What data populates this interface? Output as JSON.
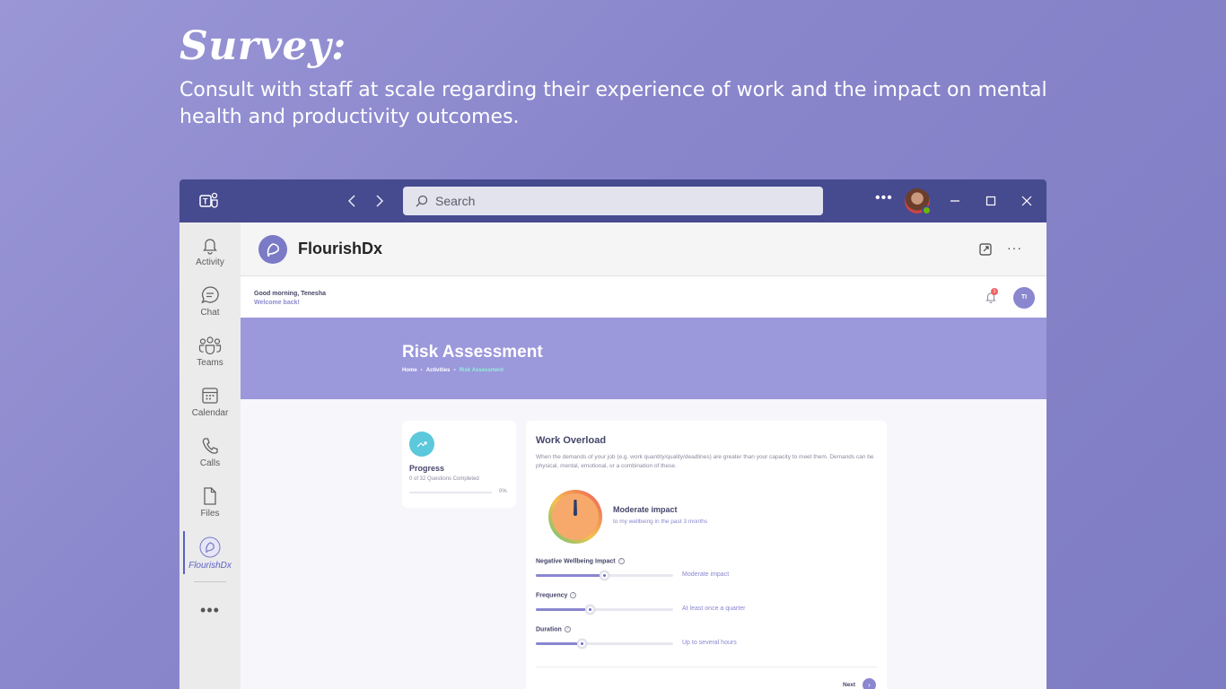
{
  "hero": {
    "title": "Survey:",
    "subtitle": "Consult with staff at scale regarding their experience of work and the impact on mental health and productivity outcomes."
  },
  "titlebar": {
    "search_placeholder": "Search",
    "more_icon": "more-horizontal-icon",
    "window_buttons": [
      "minimize-icon",
      "maximize-icon",
      "close-icon"
    ]
  },
  "rail": {
    "items": [
      {
        "label": "Activity",
        "icon": "bell-icon"
      },
      {
        "label": "Chat",
        "icon": "chat-icon"
      },
      {
        "label": "Teams",
        "icon": "teams-icon"
      },
      {
        "label": "Calendar",
        "icon": "calendar-icon"
      },
      {
        "label": "Calls",
        "icon": "phone-icon"
      },
      {
        "label": "Files",
        "icon": "file-icon"
      },
      {
        "label": "FlourishDx",
        "icon": "flourishdx-icon",
        "active": true
      }
    ],
    "more": "•••"
  },
  "app": {
    "name": "FlourishDx",
    "more": "···"
  },
  "greeting": {
    "line1": "Good morning, Tenesha",
    "line2": "Welcome back!",
    "notification_count": "1",
    "user_initials": "TI"
  },
  "banner": {
    "title": "Risk Assessment",
    "breadcrumb": [
      "Home",
      "Activities",
      "Risk Assessment"
    ]
  },
  "progress": {
    "title": "Progress",
    "subtitle": "0 of 32 Questions Completed",
    "percent_label": "0%",
    "fraction": 0
  },
  "work_overload": {
    "title": "Work Overload",
    "description": "When the demands of your job (e.g. work quantity/quality/deadlines) are greater than your capacity to meet them. Demands can be physical, mental, emotional, or a combination of these.",
    "impact_title": "Moderate impact",
    "impact_subtitle": "to my wellbeing in the past 3 months",
    "sliders": [
      {
        "label": "Negative Wellbeing Impact",
        "value_label": "Moderate impact",
        "fraction": 0.5
      },
      {
        "label": "Frequency",
        "value_label": "At least once a quarter",
        "fraction": 0.4
      },
      {
        "label": "Duration",
        "value_label": "Up to several hours",
        "fraction": 0.34
      }
    ],
    "next_label": "Next"
  },
  "colors": {
    "background": "#8a86cc",
    "titlebar": "#464a8f",
    "accent": "#8a86d0",
    "banner": "#9b98db",
    "teal": "#5bc8dc"
  }
}
